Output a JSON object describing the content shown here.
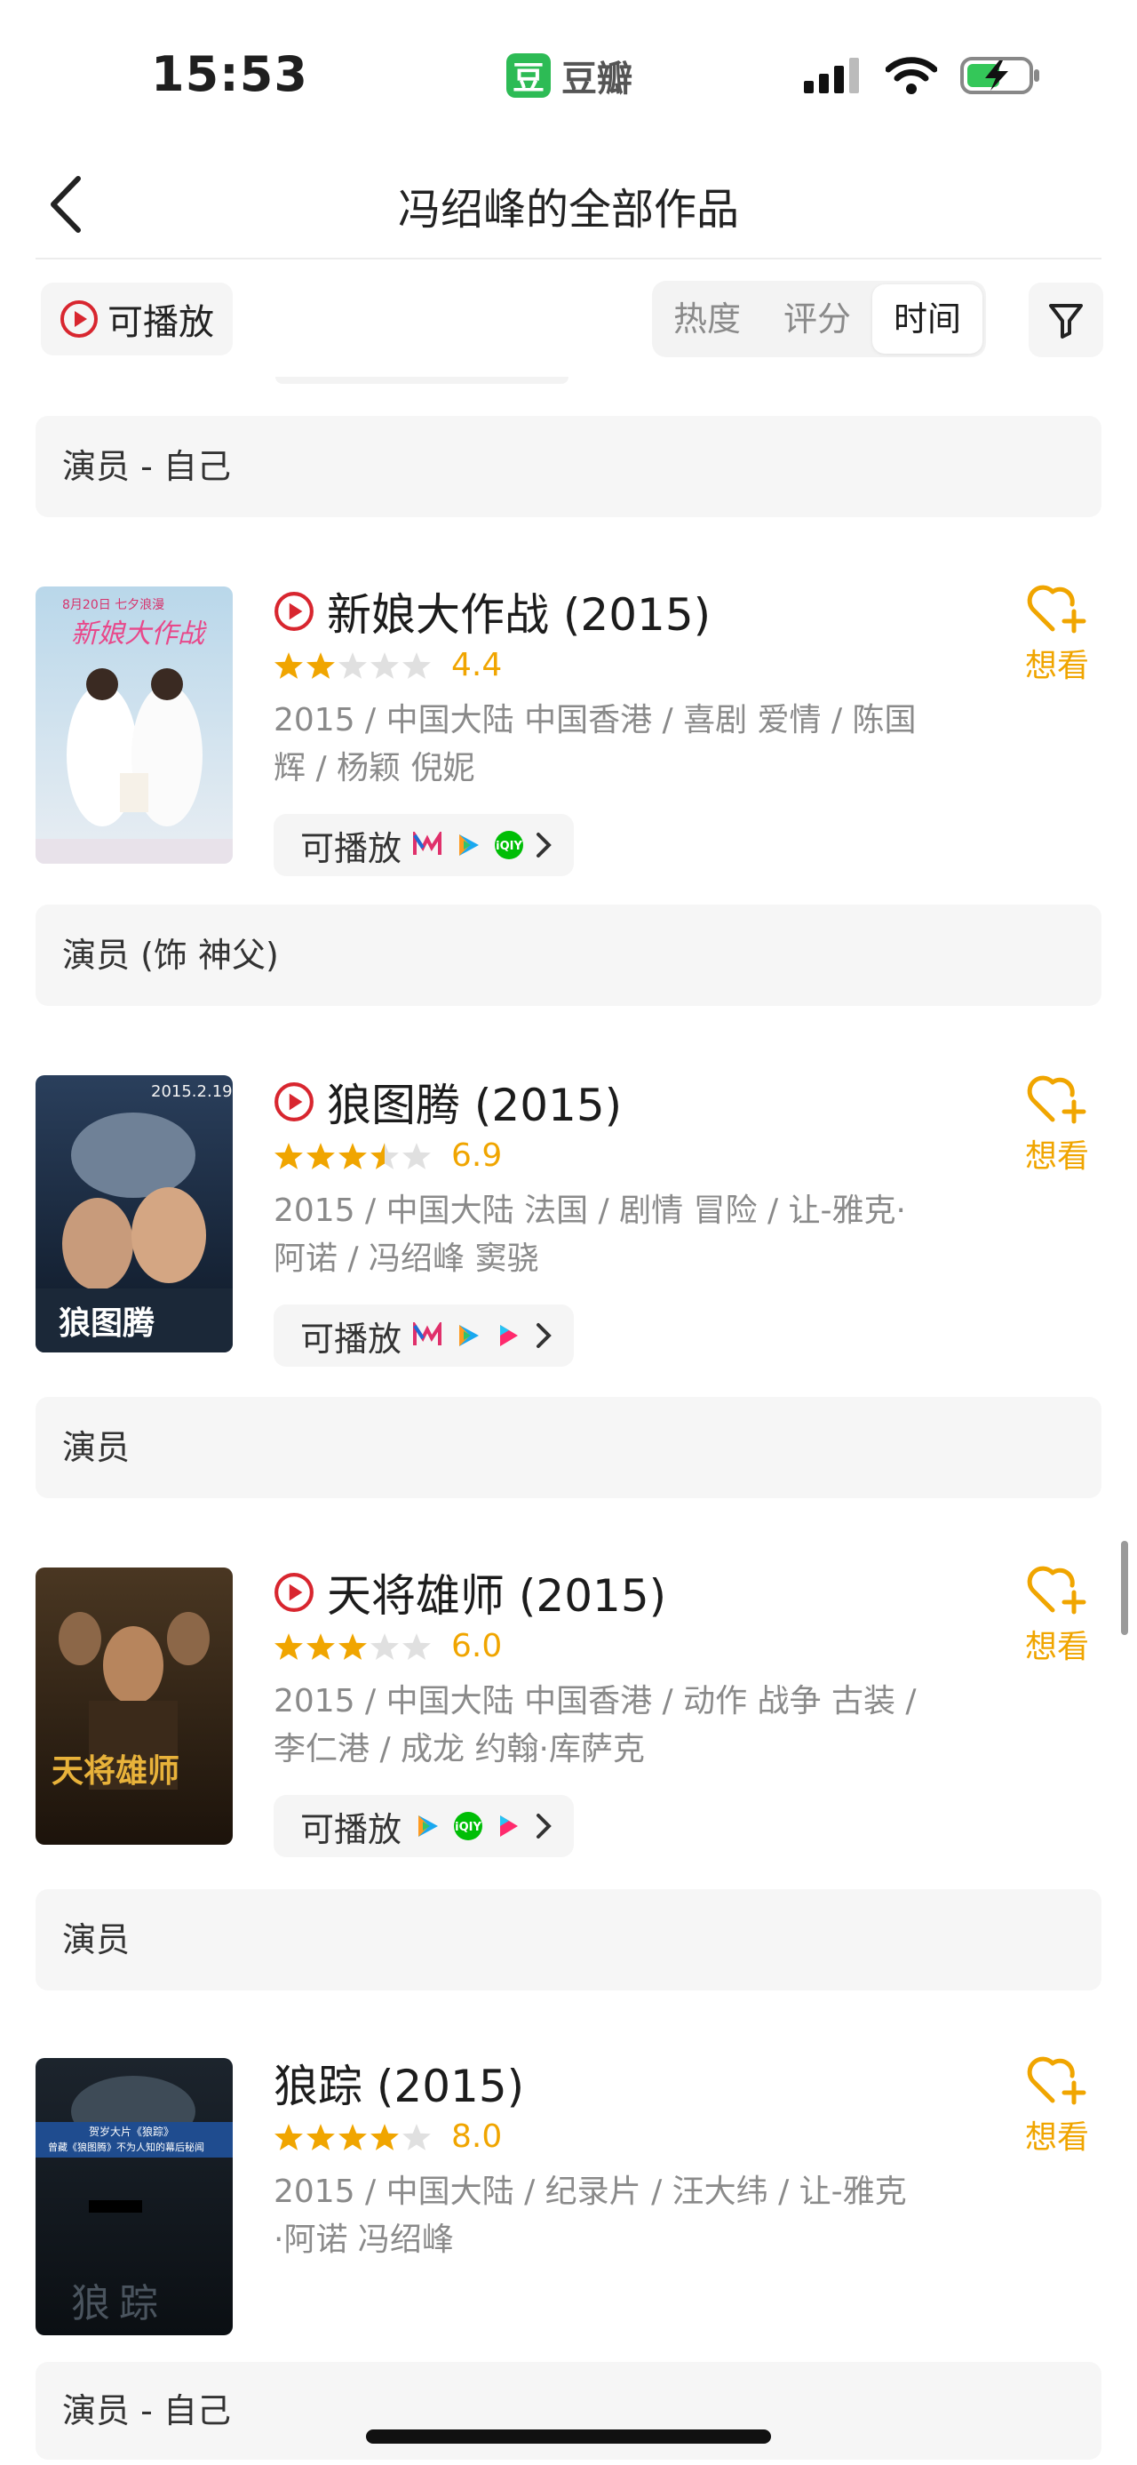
{
  "status_bar": {
    "time": "15:53",
    "app_name": "豆瓣",
    "app_logo_char": "豆",
    "logo_color": "#2dbb55",
    "battery_icon": "battery-charging-icon"
  },
  "header": {
    "title": "冯绍峰的全部作品",
    "back_icon": "chevron-left-icon"
  },
  "filter": {
    "playable_label": "可播放",
    "sort_options": [
      "热度",
      "评分",
      "时间"
    ],
    "sort_selected": "时间",
    "filter_icon": "funnel-icon"
  },
  "accent_color": "#f0a500",
  "play_color": "#d8262f",
  "roles": [
    "演员 - 自己",
    "演员 (饰 神父)",
    "演员",
    "演员",
    "演员 - 自己"
  ],
  "movies": [
    {
      "title": "新娘大作战 (2015)",
      "playable": true,
      "stars": 2,
      "score": "4.4",
      "info_line1": "2015 / 中国大陆 中国香港 / 喜剧 爱情 / 陈国",
      "info_line2": "辉 / 杨颖 倪妮",
      "play_label": "可播放",
      "platforms": [
        "mgtv-icon",
        "tencent-video-icon",
        "iqiyi-icon"
      ],
      "poster": {
        "caption": "新娘大作战",
        "date": "8月20日 七夕浪漫"
      },
      "want_label": "想看"
    },
    {
      "title": "狼图腾 (2015)",
      "playable": true,
      "stars": 3.5,
      "score": "6.9",
      "info_line1": "2015 / 中国大陆 法国 / 剧情 冒险 / 让-雅克·",
      "info_line2": "阿诺 / 冯绍峰 窦骁",
      "play_label": "可播放",
      "platforms": [
        "mgtv-icon",
        "tencent-video-icon",
        "youku-icon"
      ],
      "poster": {
        "caption": "狼图腾",
        "date": "2015.2.19"
      },
      "want_label": "想看"
    },
    {
      "title": "天将雄师 (2015)",
      "playable": true,
      "stars": 3,
      "score": "6.0",
      "info_line1": "2015 / 中国大陆 中国香港 / 动作 战争 古装 /",
      "info_line2": "李仁港 / 成龙 约翰·库萨克",
      "play_label": "可播放",
      "platforms": [
        "tencent-video-icon",
        "iqiyi-icon",
        "youku-icon"
      ],
      "poster": {
        "caption": "天将雄师",
        "date": ""
      },
      "want_label": "想看"
    },
    {
      "title": "狼踪 (2015)",
      "playable": false,
      "stars": 4,
      "score": "8.0",
      "info_line1": "2015 / 中国大陆 / 纪录片 / 汪大纬 / 让-雅克",
      "info_line2": "·阿诺 冯绍峰",
      "poster": {
        "caption": "狼踪",
        "banner1": "贺岁大片《狼踪》",
        "banner2": "曾藏《狼图腾》不为人知的幕后秘闻"
      },
      "want_label": "想看"
    }
  ]
}
